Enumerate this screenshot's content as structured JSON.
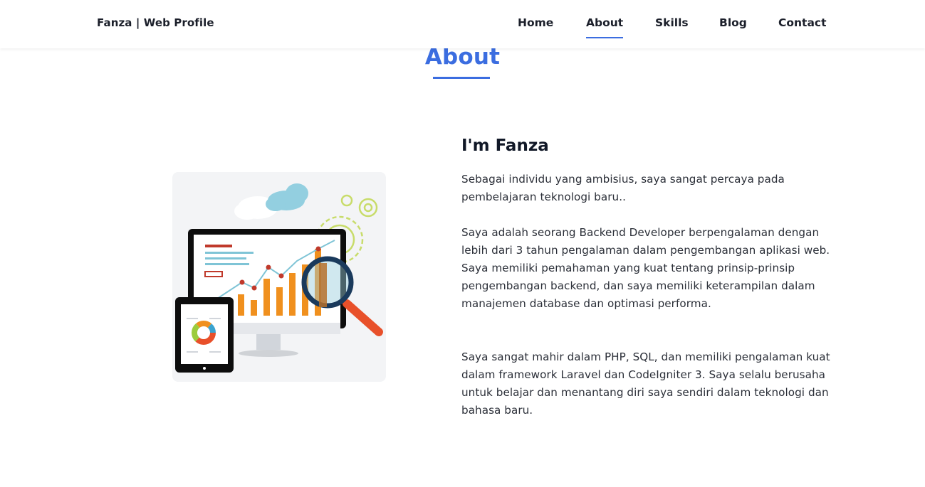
{
  "navbar": {
    "brand": "Fanza | Web Profile",
    "links": [
      {
        "label": "Home",
        "active": false
      },
      {
        "label": "About",
        "active": true
      },
      {
        "label": "Skills",
        "active": false
      },
      {
        "label": "Blog",
        "active": false
      },
      {
        "label": "Contact",
        "active": false
      }
    ]
  },
  "about": {
    "section_title": "About",
    "heading": "I'm Fanza",
    "paragraphs": [
      "Sebagai individu yang ambisius, saya sangat percaya pada pembelajaran teknologi baru..",
      "Saya adalah seorang Backend Developer berpengalaman dengan lebih dari 3 tahun pengalaman dalam pengembangan aplikasi web. Saya memiliki pemahaman yang kuat tentang prinsip-prinsip pengembangan backend, dan saya memiliki keterampilan dalam manajemen database dan optimasi performa.",
      "Saya sangat mahir dalam PHP, SQL, dan memiliki pengalaman kuat dalam framework Laravel dan CodeIgniter 3. Saya selalu berusaha untuk belajar dan menantang diri saya sendiri dalam teknologi dan bahasa baru."
    ],
    "illustration_icon": "analytics-dashboard-illustration"
  },
  "colors": {
    "accent": "#3b6de0",
    "text_dark": "#111827",
    "bar_orange": "#f0901e",
    "magnifier_red": "#e8502a"
  }
}
